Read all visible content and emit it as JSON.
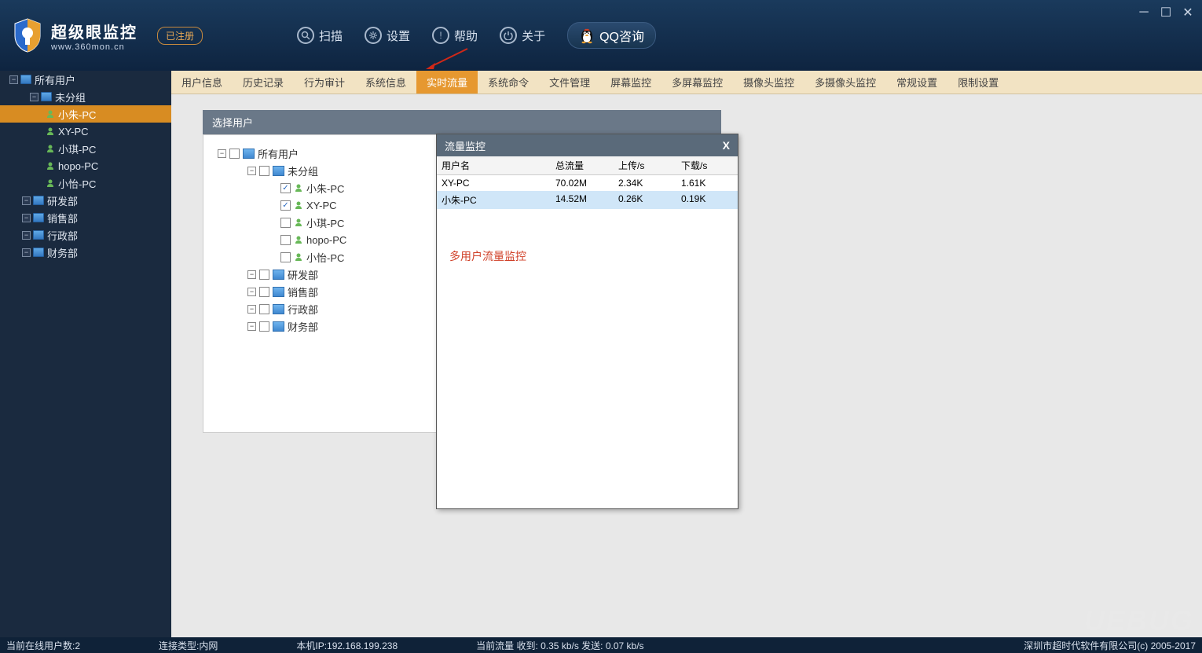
{
  "app": {
    "name_cn": "超级眼监控",
    "name_en": "www.360mon.cn",
    "reg_status": "已注册"
  },
  "toolbar": {
    "scan": "扫描",
    "settings": "设置",
    "help": "帮助",
    "about": "关于",
    "qq": "QQ咨询"
  },
  "sidebar": {
    "root": "所有用户",
    "ungrouped": "未分组",
    "users": [
      "小朱-PC",
      "XY-PC",
      "小琪-PC",
      "hopo-PC",
      "小怡-PC"
    ],
    "depts": [
      "研发部",
      "销售部",
      "行政部",
      "财务部"
    ]
  },
  "tabs": [
    "用户信息",
    "历史记录",
    "行为审计",
    "系统信息",
    "实时流量",
    "系统命令",
    "文件管理",
    "屏幕监控",
    "多屏幕监控",
    "摄像头监控",
    "多摄像头监控",
    "常规设置",
    "限制设置"
  ],
  "active_tab_index": 4,
  "panel": {
    "header": "选择用户",
    "root": "所有用户",
    "ungrouped": "未分组",
    "users": [
      {
        "name": "小朱-PC",
        "checked": true
      },
      {
        "name": "XY-PC",
        "checked": true
      },
      {
        "name": "小琪-PC",
        "checked": false
      },
      {
        "name": "hopo-PC",
        "checked": false
      },
      {
        "name": "小怡-PC",
        "checked": false
      }
    ],
    "depts": [
      "研发部",
      "销售部",
      "行政部",
      "财务部"
    ]
  },
  "dialog": {
    "title": "流量监控",
    "headers": {
      "user": "用户名",
      "total": "总流量",
      "up": "上传/s",
      "down": "下载/s"
    },
    "rows": [
      {
        "user": "XY-PC",
        "total": "70.02M",
        "up": "2.34K",
        "down": "1.61K"
      },
      {
        "user": "小朱-PC",
        "total": "14.52M",
        "up": "0.26K",
        "down": "0.19K"
      }
    ],
    "annotation": "多用户流量监控"
  },
  "statusbar": {
    "online": "当前在线用户数:2",
    "conn": "连接类型:内网",
    "ip": "本机IP:192.168.199.238",
    "traffic": "当前流量 收到: 0.35 kb/s    发送: 0.07 kb/s",
    "copyright": "深圳市超时代软件有限公司(c) 2005-2017"
  },
  "watermark": "UEBUG"
}
